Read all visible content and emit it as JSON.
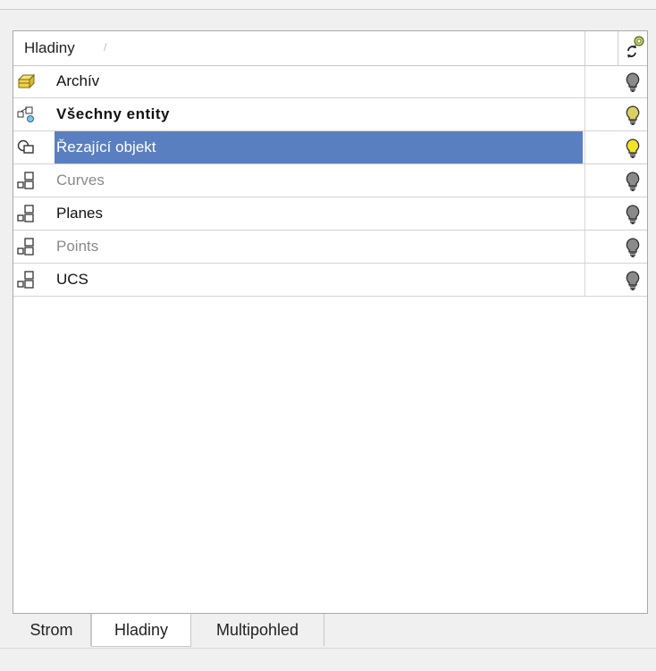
{
  "header": {
    "title": "Hladiny",
    "sort_indicator": "/"
  },
  "layers": [
    {
      "label": "Archív",
      "icon": "archive-icon",
      "style": "normal",
      "bulb": "off"
    },
    {
      "label": "Všechny entity",
      "icon": "all-entities-icon",
      "style": "bold",
      "bulb": "half"
    },
    {
      "label": "Řezající objekt",
      "icon": "cutting-object-icon",
      "style": "selected",
      "bulb": "on"
    },
    {
      "label": "Curves",
      "icon": "layer-icon",
      "style": "dim",
      "bulb": "off"
    },
    {
      "label": "Planes",
      "icon": "layer-icon",
      "style": "normal",
      "bulb": "off"
    },
    {
      "label": "Points",
      "icon": "layer-icon",
      "style": "dim",
      "bulb": "off"
    },
    {
      "label": "UCS",
      "icon": "layer-icon",
      "style": "normal",
      "bulb": "off"
    }
  ],
  "tabs": [
    {
      "label": "Strom",
      "active": false
    },
    {
      "label": "Hladiny",
      "active": true
    },
    {
      "label": "Multipohled",
      "active": false
    }
  ],
  "colors": {
    "selection": "#5a7fc0",
    "bulb_on": "#f2e22a",
    "bulb_off": "#8a8a8a"
  }
}
